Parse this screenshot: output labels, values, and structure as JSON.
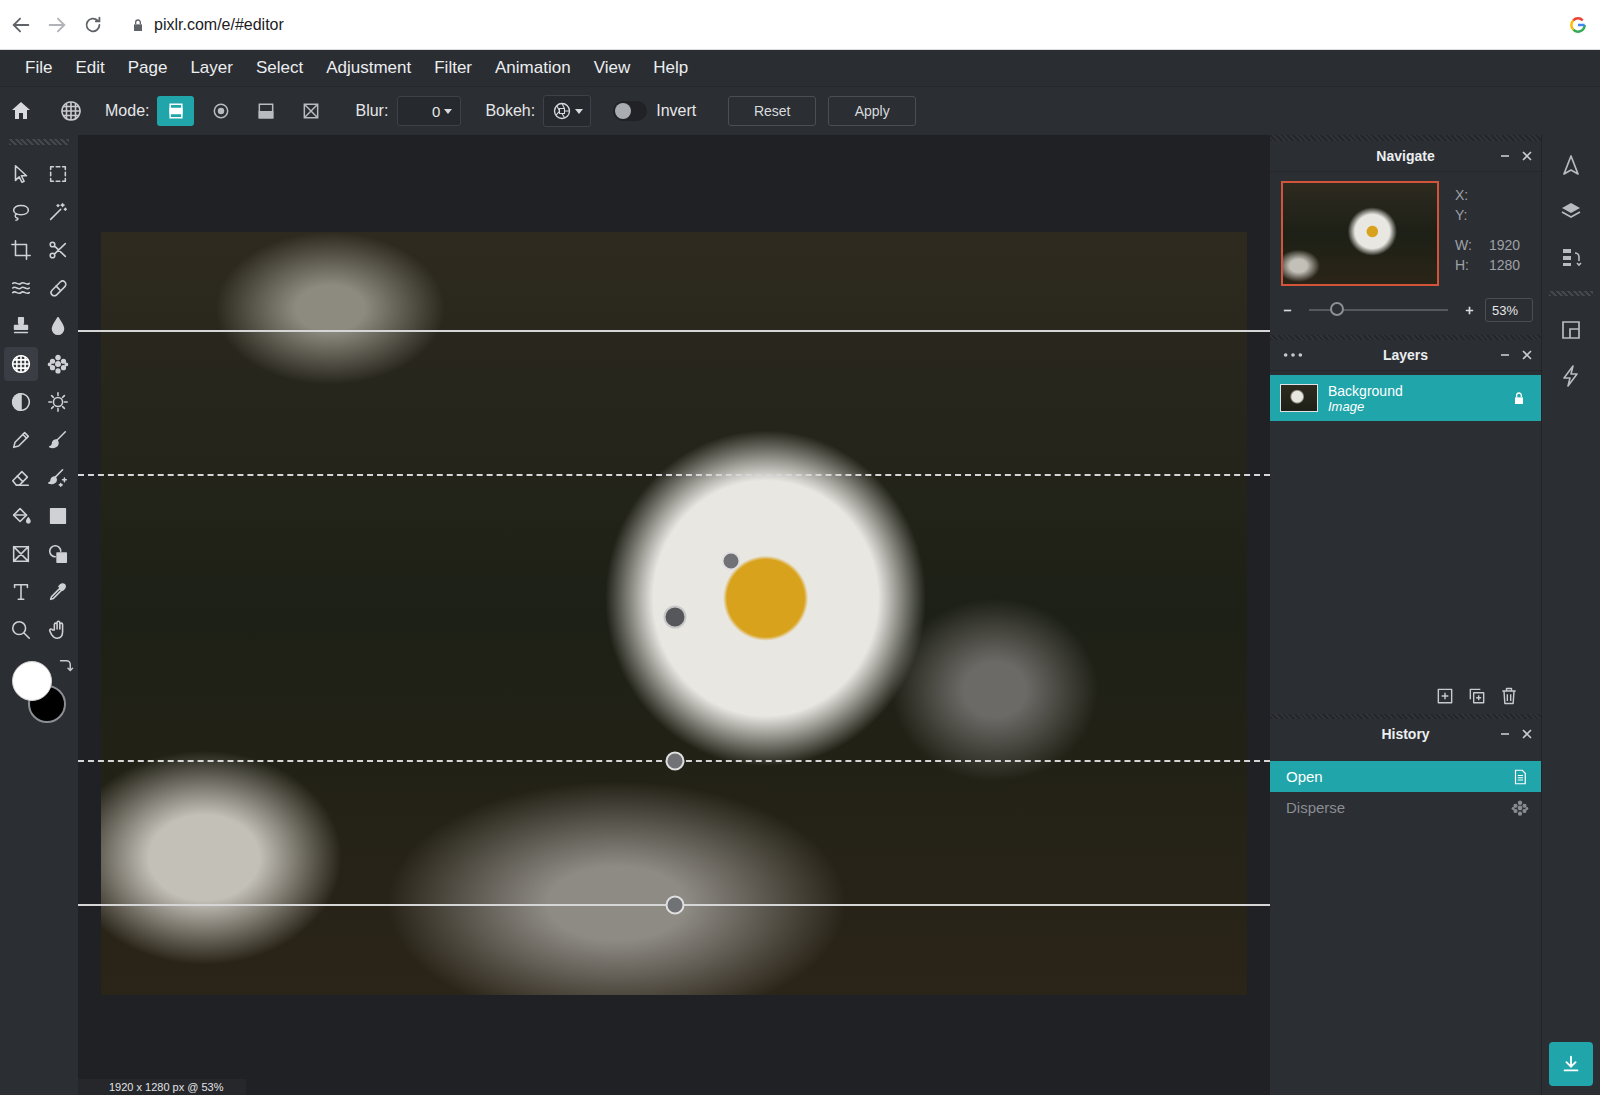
{
  "browser": {
    "url": "pixlr.com/e/#editor"
  },
  "menu": [
    "File",
    "Edit",
    "Page",
    "Layer",
    "Select",
    "Adjustment",
    "Filter",
    "Animation",
    "View",
    "Help"
  ],
  "options": {
    "mode_label": "Mode:",
    "modes": [
      {
        "kind": "linear",
        "selected": true
      },
      {
        "kind": "radial",
        "selected": false
      },
      {
        "kind": "rectangle",
        "selected": false
      },
      {
        "kind": "none",
        "selected": false
      }
    ],
    "blur": {
      "label": "Blur:",
      "value": "0"
    },
    "bokeh": {
      "label": "Bokeh:"
    },
    "invert": {
      "label": "Invert",
      "on": false
    },
    "buttons": [
      "Reset",
      "Apply"
    ]
  },
  "tools": [
    {
      "kind": "move",
      "selected": false
    },
    {
      "kind": "marquee",
      "selected": false
    },
    {
      "kind": "lasso",
      "selected": false
    },
    {
      "kind": "wand",
      "selected": false
    },
    {
      "kind": "crop",
      "selected": false
    },
    {
      "kind": "cutout",
      "selected": false
    },
    {
      "kind": "liquify",
      "selected": false
    },
    {
      "kind": "heal",
      "selected": false
    },
    {
      "kind": "clone",
      "selected": false
    },
    {
      "kind": "blur",
      "selected": false
    },
    {
      "kind": "focus",
      "selected": true
    },
    {
      "kind": "disperse",
      "selected": false
    },
    {
      "kind": "dodge",
      "selected": false
    },
    {
      "kind": "sponge",
      "selected": false
    },
    {
      "kind": "pencil",
      "selected": false
    },
    {
      "kind": "brush",
      "selected": false
    },
    {
      "kind": "eraser",
      "selected": false
    },
    {
      "kind": "replace",
      "selected": false
    },
    {
      "kind": "fill",
      "selected": false
    },
    {
      "kind": "gradient",
      "selected": false
    },
    {
      "kind": "shape",
      "selected": false
    },
    {
      "kind": "draw",
      "selected": false
    },
    {
      "kind": "text",
      "selected": false
    },
    {
      "kind": "picker",
      "selected": false
    },
    {
      "kind": "zoom",
      "selected": false
    },
    {
      "kind": "hand",
      "selected": false
    }
  ],
  "swatches": {
    "primary": "#ffffff",
    "secondary": "#000000"
  },
  "canvas": {
    "status": "1920 x 1280 px @ 53%"
  },
  "navigate": {
    "title": "Navigate",
    "fields": [
      {
        "label": "X:",
        "value": ""
      },
      {
        "label": "Y:",
        "value": ""
      },
      {
        "label": "W:",
        "value": "1920"
      },
      {
        "label": "H:",
        "value": "1280"
      }
    ],
    "zoom": {
      "value": "53%",
      "level": 0.2
    }
  },
  "layers": {
    "title": "Layers",
    "items": [
      {
        "name": "Background",
        "type": "Image",
        "locked": true,
        "selected": true
      }
    ]
  },
  "history": {
    "title": "History",
    "items": [
      {
        "label": "Open",
        "kind": "open",
        "selected": true
      },
      {
        "label": "Disperse",
        "kind": "disperse",
        "selected": false
      }
    ]
  }
}
